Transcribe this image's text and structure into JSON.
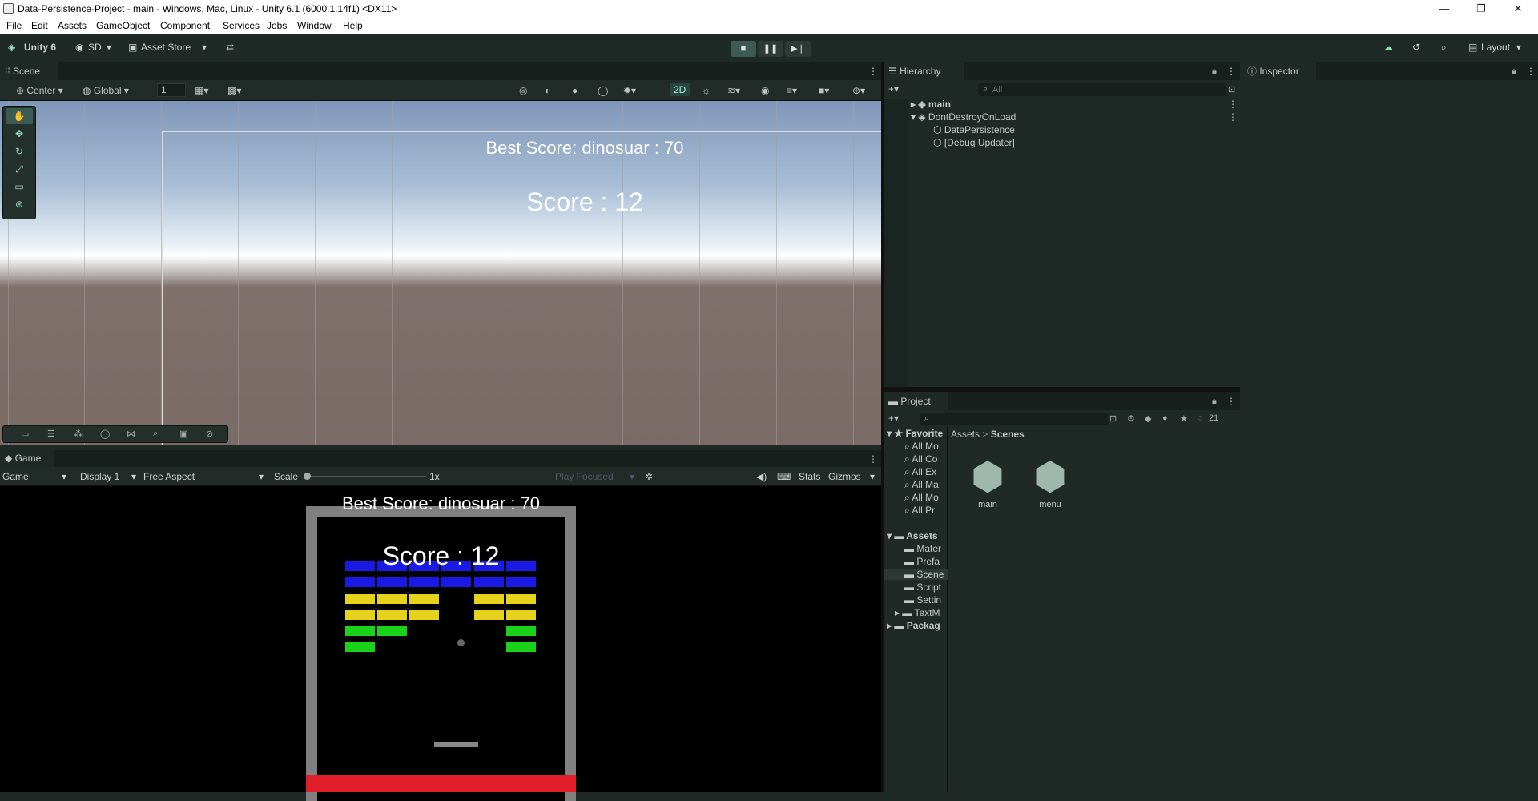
{
  "window": {
    "title": "Data-Persistence-Project - main - Windows, Mac, Linux - Unity 6.1 (6000.1.14f1) <DX11>",
    "minimize": "—",
    "maximize": "❐",
    "close": "✕"
  },
  "menu": [
    "File",
    "Edit",
    "Assets",
    "GameObject",
    "Component",
    "Services",
    "Jobs",
    "Window",
    "Help"
  ],
  "toolbar": {
    "unity": "Unity 6",
    "account": "SD",
    "asset_store": "Asset Store",
    "layout": "Layout"
  },
  "scene": {
    "tab": "Scene",
    "pivot": "Center",
    "space": "Global",
    "grid_size": "1",
    "mode_2d": "2D",
    "best_score": "Best Score: dinosuar : 70",
    "score": "Score : 12"
  },
  "game": {
    "tab": "Game",
    "view": "Game",
    "display": "Display 1",
    "aspect": "Free Aspect",
    "scale_label": "Scale",
    "scale_value": "1x",
    "play_focused": "Play Focused",
    "stats": "Stats",
    "gizmos": "Gizmos",
    "best_score": "Best Score: dinosuar : 70",
    "score": "Score : 12",
    "colors": {
      "blue": "#1a1ae6",
      "yellow": "#e6d21a",
      "green": "#1ad21a",
      "wall": "#808080",
      "floor": "#e01e2a"
    }
  },
  "hierarchy": {
    "tab": "Hierarchy",
    "search_placeholder": "All",
    "items": [
      "main",
      "DontDestroyOnLoad",
      "DataPersistence",
      "[Debug Updater]"
    ]
  },
  "inspector": {
    "tab": "Inspector"
  },
  "project": {
    "tab": "Project",
    "count": "21",
    "favorites_label": "Favorite",
    "favorites": [
      "All Mo",
      "All Co",
      "All Ex",
      "All Ma",
      "All Mo",
      "All Pr"
    ],
    "assets_label": "Assets",
    "folders": [
      "Mater",
      "Prefa",
      "Scene",
      "Script",
      "Settin",
      "TextM"
    ],
    "packages": "Packag",
    "breadcrumb": [
      "Assets",
      "Scenes"
    ],
    "scenes": [
      "main",
      "menu"
    ]
  }
}
